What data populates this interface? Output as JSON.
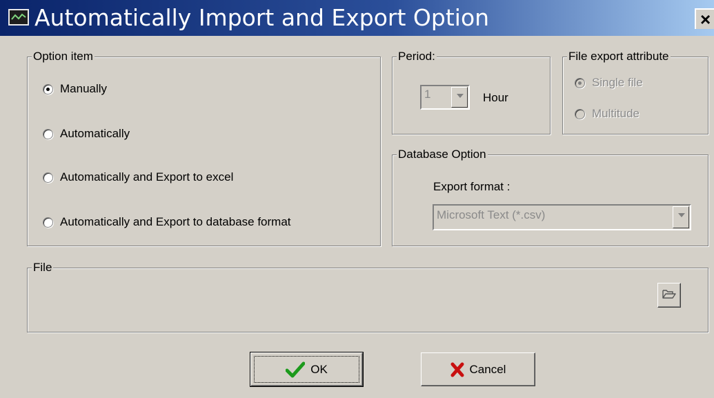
{
  "window": {
    "title": "Automatically Import and Export Option",
    "close_glyph": "×"
  },
  "option_item": {
    "legend": "Option item",
    "options": [
      {
        "label": "Manually",
        "checked": true
      },
      {
        "label": "Automatically",
        "checked": false
      },
      {
        "label": "Automatically and Export to excel",
        "checked": false
      },
      {
        "label": "Automatically and Export to database format",
        "checked": false
      }
    ]
  },
  "period": {
    "legend": "Period:",
    "value": "1",
    "unit": "Hour"
  },
  "file_export_attribute": {
    "legend": "File export attribute",
    "options": [
      {
        "label": "Single file",
        "checked": true,
        "disabled": true
      },
      {
        "label": "Multitude",
        "checked": false,
        "disabled": true
      }
    ]
  },
  "database_option": {
    "legend": "Database Option",
    "export_format_label": "Export format :",
    "export_format_value": "Microsoft Text (*.csv)"
  },
  "file": {
    "legend": "File"
  },
  "buttons": {
    "ok_label": "OK",
    "cancel_label": "Cancel"
  },
  "icons": {
    "app": "window-app-icon",
    "close": "close-icon",
    "browse": "folder-open-icon",
    "ok": "check-icon",
    "cancel": "x-mark-icon"
  },
  "colors": {
    "dialog_bg": "#d4d0c8",
    "titlebar_start": "#0a246a",
    "titlebar_end": "#a6caf0",
    "ok_check": "#1c9a1c",
    "cancel_x": "#c81010"
  }
}
